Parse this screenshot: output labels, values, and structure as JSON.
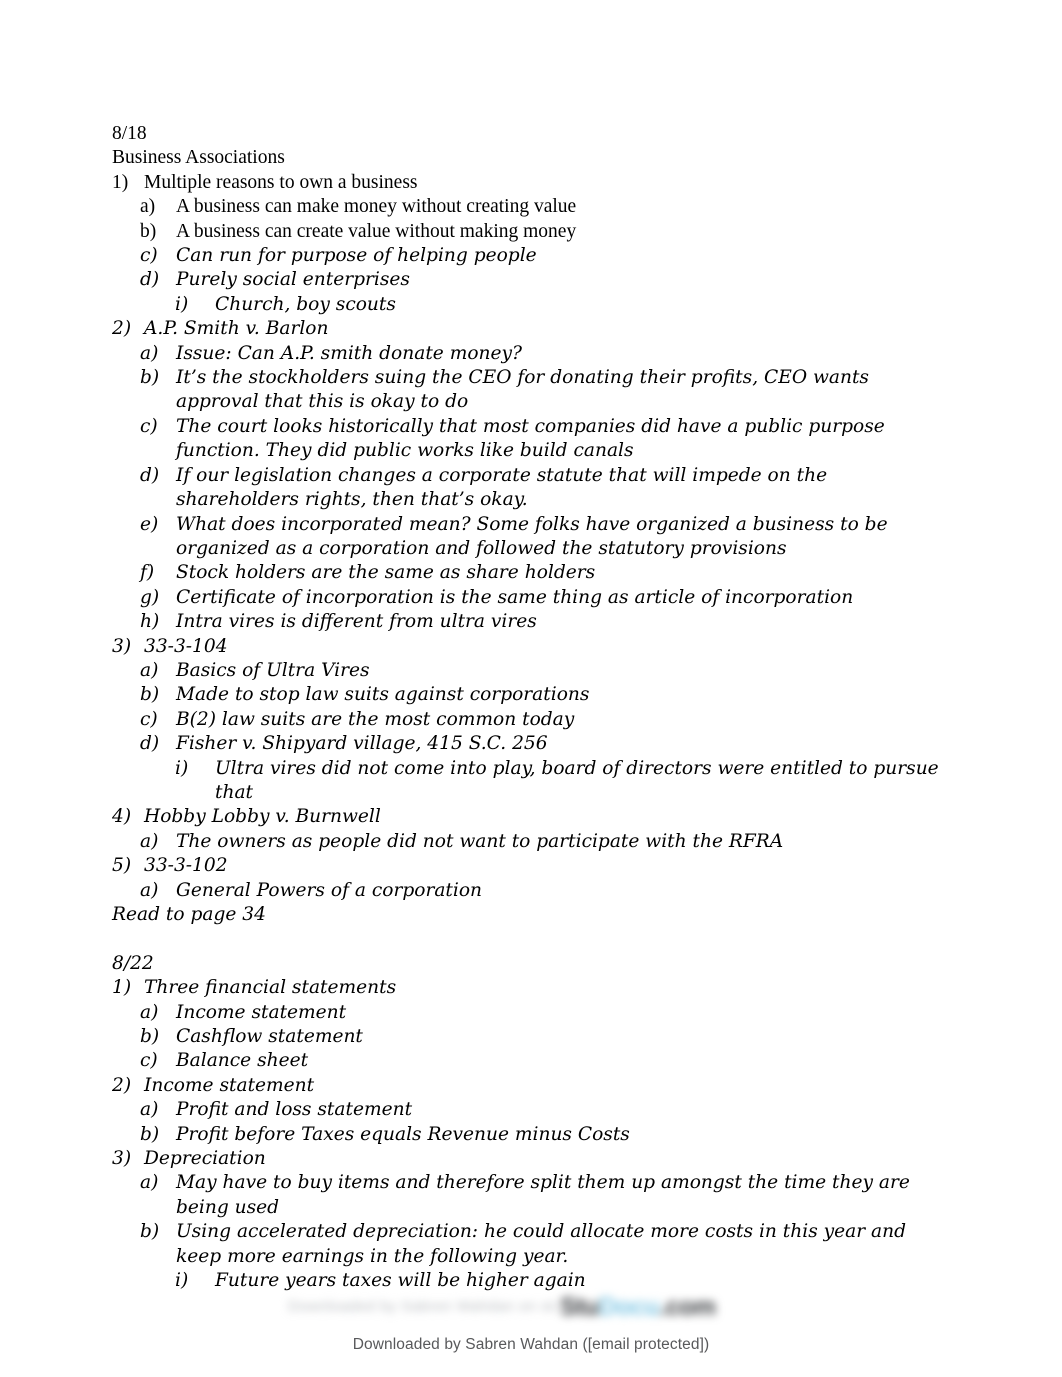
{
  "document": {
    "sections": [
      {
        "id": "section-8-18",
        "heading_date": "8/18",
        "heading_title": "Business Associations",
        "items": [
          {
            "level": 1,
            "marker": "1)",
            "text": "Multiple reasons to own a business",
            "style": "plain"
          },
          {
            "level": 2,
            "marker": "a)",
            "text": "A business can make money without creating value",
            "style": "plain"
          },
          {
            "level": 2,
            "marker": "b)",
            "text": "A business can create value without making money",
            "style": "plain"
          },
          {
            "level": 2,
            "marker": "c)",
            "text": "Can run for purpose of helping people",
            "style": "italic"
          },
          {
            "level": 2,
            "marker": "d)",
            "text": "Purely social enterprises",
            "style": "italic"
          },
          {
            "level": 3,
            "marker": "i)",
            "text": "Church, boy scouts",
            "style": "italic"
          },
          {
            "level": 1,
            "marker": "2)",
            "text": "A.P. Smith v. Barlon",
            "style": "italic"
          },
          {
            "level": 2,
            "marker": "a)",
            "text": "Issue: Can A.P. smith donate money?",
            "style": "italic"
          },
          {
            "level": 2,
            "marker": "b)",
            "text": "It’s the stockholders suing the CEO for donating their profits, CEO wants approval that this is okay to do",
            "style": "italic"
          },
          {
            "level": 2,
            "marker": "c)",
            "text": "The court looks historically that most companies did have a public purpose function. They did public works like build canals",
            "style": "italic"
          },
          {
            "level": 2,
            "marker": "d)",
            "text": "If our legislation changes a corporate statute that will impede on the shareholders rights, then that’s okay.",
            "style": "italic"
          },
          {
            "level": 2,
            "marker": "e)",
            "text": "What does incorporated mean? Some folks have organized a business to be organized as a corporation and followed the statutory provisions",
            "style": "italic"
          },
          {
            "level": 2,
            "marker": "f)",
            "text": "Stock holders are the same as share holders",
            "style": "italic"
          },
          {
            "level": 2,
            "marker": "g)",
            "text": "Certificate of incorporation is the same thing as article of incorporation",
            "style": "italic"
          },
          {
            "level": 2,
            "marker": "h)",
            "text": "Intra vires is different from ultra vires",
            "style": "italic"
          },
          {
            "level": 1,
            "marker": "3)",
            "text": "33-3-104",
            "style": "italic"
          },
          {
            "level": 2,
            "marker": "a)",
            "text": "Basics of Ultra Vires",
            "style": "italic"
          },
          {
            "level": 2,
            "marker": "b)",
            "text": "Made to stop law suits against corporations",
            "style": "italic"
          },
          {
            "level": 2,
            "marker": "c)",
            "text": "B(2) law suits are the most common today",
            "style": "italic"
          },
          {
            "level": 2,
            "marker": "d)",
            "text": "Fisher v. Shipyard village, 415 S.C. 256",
            "style": "italic"
          },
          {
            "level": 3,
            "marker": "i)",
            "text": "Ultra vires did not come into play, board of directors were entitled to pursue that",
            "style": "italic"
          },
          {
            "level": 1,
            "marker": "4)",
            "text": "Hobby Lobby v. Burnwell",
            "style": "italic"
          },
          {
            "level": 2,
            "marker": "a)",
            "text": "The owners as people did not want to participate with the RFRA",
            "style": "italic"
          },
          {
            "level": 1,
            "marker": "5)",
            "text": "33-3-102",
            "style": "italic"
          },
          {
            "level": 2,
            "marker": "a)",
            "text": "General Powers of a corporation",
            "style": "italic"
          }
        ],
        "closing_note": "Read to page 34"
      },
      {
        "id": "section-8-22",
        "heading_date": "8/22",
        "items": [
          {
            "level": 1,
            "marker": "1)",
            "text": "Three financial statements",
            "style": "italic"
          },
          {
            "level": 2,
            "marker": "a)",
            "text": "Income statement",
            "style": "italic"
          },
          {
            "level": 2,
            "marker": "b)",
            "text": "Cashflow statement",
            "style": "italic"
          },
          {
            "level": 2,
            "marker": "c)",
            "text": "Balance sheet",
            "style": "italic"
          },
          {
            "level": 1,
            "marker": "2)",
            "text": "Income statement",
            "style": "italic"
          },
          {
            "level": 2,
            "marker": "a)",
            "text": "Profit and loss statement",
            "style": "italic"
          },
          {
            "level": 2,
            "marker": "b)",
            "text": "Profit before Taxes equals Revenue minus Costs",
            "style": "italic"
          },
          {
            "level": 1,
            "marker": "3)",
            "text": "Depreciation",
            "style": "italic"
          },
          {
            "level": 2,
            "marker": "a)",
            "text": "May have to buy items and therefore split them up amongst the time they are being used",
            "style": "italic"
          },
          {
            "level": 2,
            "marker": "b)",
            "text": "Using accelerated depreciation: he could allocate more costs in this year and keep more earnings in the following year.",
            "style": "italic"
          },
          {
            "level": 3,
            "marker": "i)",
            "text": "Future years taxes will be higher again",
            "style": "italic"
          }
        ]
      }
    ]
  },
  "footer": {
    "watermark_left": "Downloaded by Sabren Wahdan on studocu",
    "watermark_logo_part1": "Stu",
    "watermark_logo_part2": "Docu",
    "watermark_logo_part3": ".com",
    "downloaded_by": "Downloaded by Sabren Wahdan ([email protected])"
  }
}
